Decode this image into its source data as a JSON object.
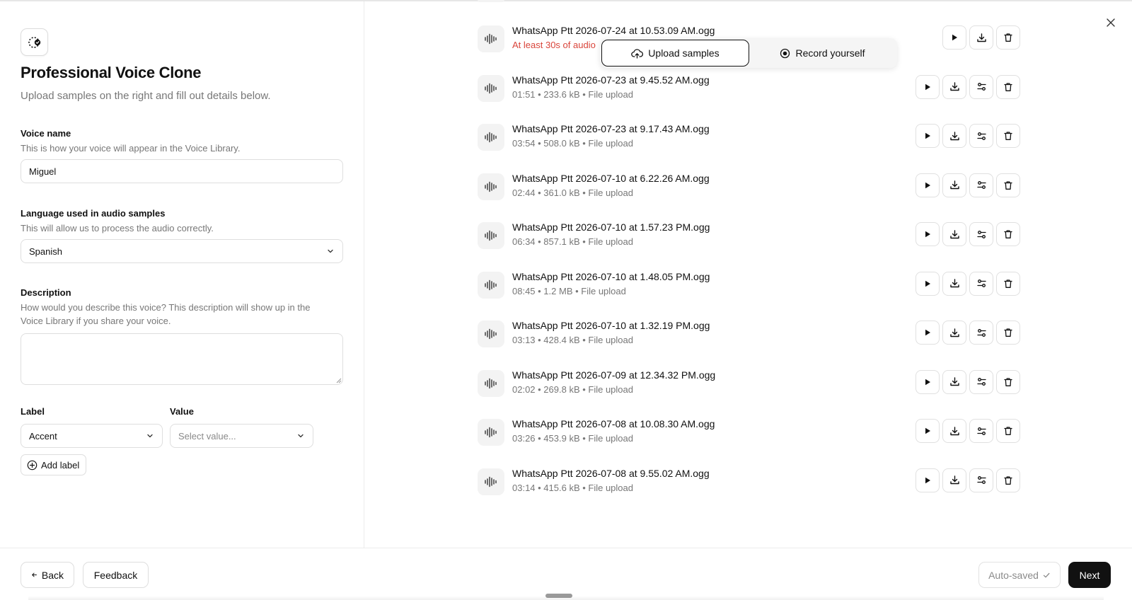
{
  "panel": {
    "title": "Professional Voice Clone",
    "subtitle": "Upload samples on the right and fill out details below."
  },
  "voice_name": {
    "label": "Voice name",
    "help": "This is how your voice will appear in the Voice Library.",
    "value": "Miguel"
  },
  "language": {
    "label": "Language used in audio samples",
    "help": "This will allow us to process the audio correctly.",
    "value": "Spanish"
  },
  "description": {
    "label": "Description",
    "help_line1": "How would you describe this voice? This description will show up in the",
    "help_line2": "Voice Library if you share your voice.",
    "value": ""
  },
  "labels": {
    "label_header": "Label",
    "value_header": "Value",
    "label_value": "Accent",
    "value_placeholder": "Select value...",
    "add_label": "Add label"
  },
  "toggle": {
    "upload": "Upload samples",
    "record": "Record yourself",
    "active": "upload"
  },
  "files": [
    {
      "name": "WhatsApp Ptt 2026-07-24 at 10.53.09 AM.ogg",
      "meta": "At least 30s of audio",
      "warning": true
    },
    {
      "name": "WhatsApp Ptt 2026-07-23 at 9.45.52 AM.ogg",
      "meta": "01:51 • 233.6 kB • File upload",
      "warning": false
    },
    {
      "name": "WhatsApp Ptt 2026-07-23 at 9.17.43 AM.ogg",
      "meta": "03:54 • 508.0 kB • File upload",
      "warning": false
    },
    {
      "name": "WhatsApp Ptt 2026-07-10 at 6.22.26 AM.ogg",
      "meta": "02:44 • 361.0 kB • File upload",
      "warning": false
    },
    {
      "name": "WhatsApp Ptt 2026-07-10 at 1.57.23 PM.ogg",
      "meta": "06:34 • 857.1 kB • File upload",
      "warning": false
    },
    {
      "name": "WhatsApp Ptt 2026-07-10 at 1.48.05 PM.ogg",
      "meta": "08:45 • 1.2 MB • File upload",
      "warning": false
    },
    {
      "name": "WhatsApp Ptt 2026-07-10 at 1.32.19 PM.ogg",
      "meta": "03:13 • 428.4 kB • File upload",
      "warning": false
    },
    {
      "name": "WhatsApp Ptt 2026-07-09 at 12.34.32 PM.ogg",
      "meta": "02:02 • 269.8 kB • File upload",
      "warning": false
    },
    {
      "name": "WhatsApp Ptt 2026-07-08 at 10.08.30 AM.ogg",
      "meta": "03:26 • 453.9 kB • File upload",
      "warning": false
    },
    {
      "name": "WhatsApp Ptt 2026-07-08 at 9.55.02 AM.ogg",
      "meta": "03:14 • 415.6 kB • File upload",
      "warning": false
    }
  ],
  "footer": {
    "back": "Back",
    "feedback": "Feedback",
    "autosaved": "Auto-saved",
    "next": "Next"
  },
  "colors": {
    "warning": "#d9443a",
    "primary": "#111111",
    "muted": "#777777"
  },
  "icons": {
    "logo": "voice-clone-logo-icon",
    "wave": "waveform-icon",
    "play": "play-icon",
    "download": "download-icon",
    "adjust": "adjust-icon",
    "delete": "trash-icon",
    "close": "close-icon"
  }
}
